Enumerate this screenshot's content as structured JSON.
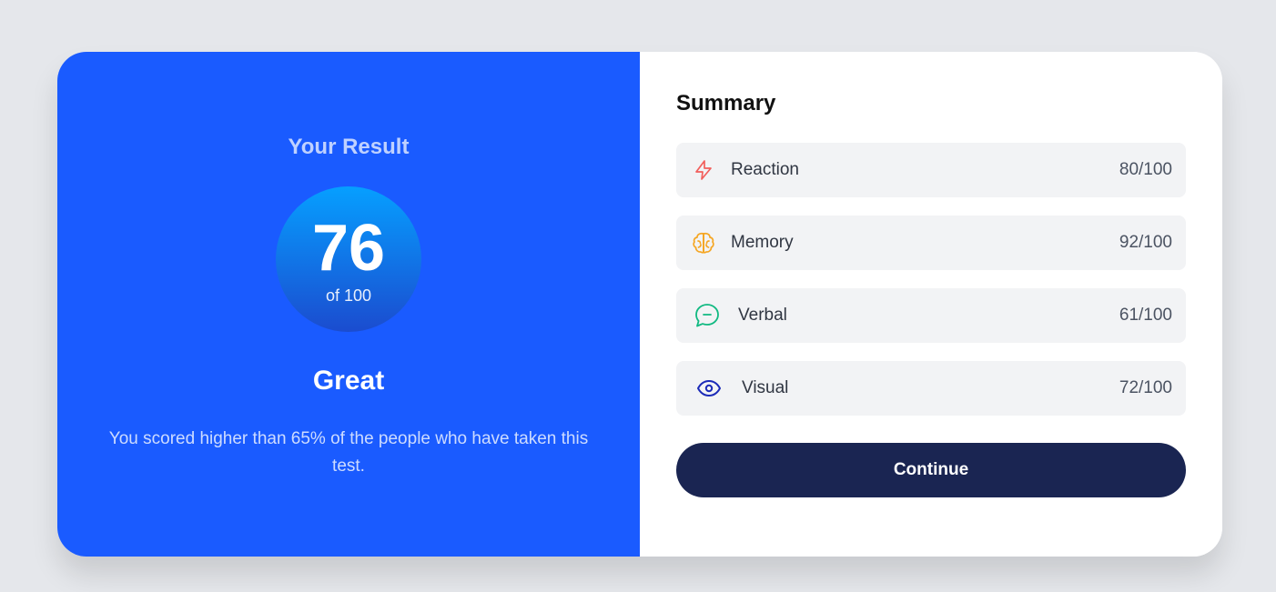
{
  "result": {
    "title": "Your Result",
    "score": "76",
    "score_total": "of 100",
    "rating": "Great",
    "message": "You scored higher than 65% of the people who have taken this test."
  },
  "summary": {
    "title": "Summary",
    "items": [
      {
        "label": "Reaction",
        "score": "80/100",
        "icon": "lightning-icon",
        "color": "#f25f5c"
      },
      {
        "label": "Memory",
        "score": "92/100",
        "icon": "brain-icon",
        "color": "#f5a623"
      },
      {
        "label": "Verbal",
        "score": "61/100",
        "icon": "chat-bubble-icon",
        "color": "#10b981"
      },
      {
        "label": "Visual",
        "score": "72/100",
        "icon": "eye-icon",
        "color": "#1c2bb8"
      }
    ],
    "continue_label": "Continue"
  },
  "colors": {
    "result_panel": "#1a5bff",
    "continue_button": "#1a2552",
    "row_background": "#f2f3f5"
  }
}
